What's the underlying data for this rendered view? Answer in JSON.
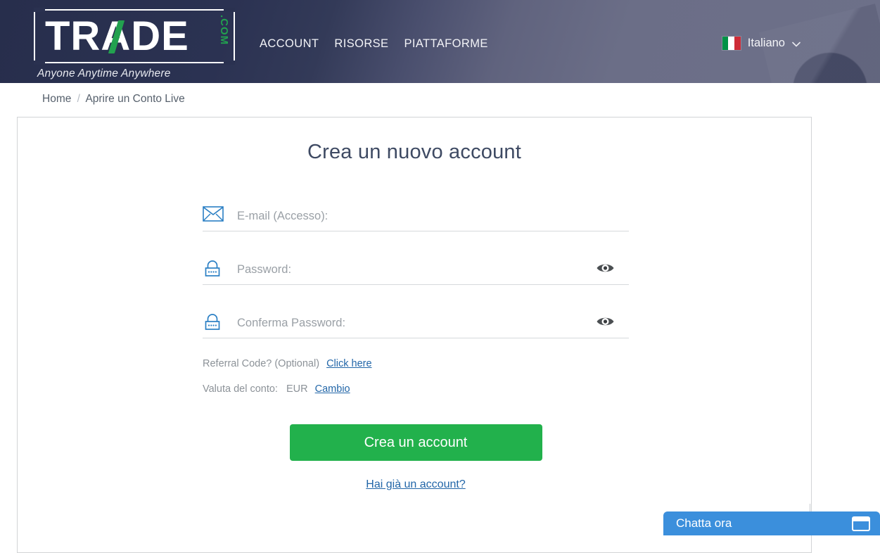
{
  "header": {
    "logo": {
      "word": "TRADE",
      "suffix": ".COM",
      "tagline": "Anyone Anytime Anywhere"
    },
    "nav": [
      {
        "label": "ACCOUNT"
      },
      {
        "label": "RISORSE"
      },
      {
        "label": "PIATTAFORME"
      }
    ],
    "language": {
      "label": "Italiano",
      "chevron": "⌄",
      "flag": "italy-flag"
    },
    "colors": {
      "dark": "#272e4c",
      "light": "#6d7089",
      "accent_green": "#22a14f"
    }
  },
  "breadcrumb": {
    "home": "Home",
    "separator": "/",
    "current": "Aprire un Conto Live"
  },
  "main": {
    "title": "Crea un nuovo account",
    "fields": [
      {
        "name": "email",
        "placeholder": "E-mail (Accesso):",
        "value": "",
        "icon": "envelope-icon"
      },
      {
        "name": "password",
        "placeholder": "Password:",
        "value": "",
        "icon": "lock-icon",
        "toggle": "eye-icon"
      },
      {
        "name": "confirm_password",
        "placeholder": "Conferma Password:",
        "value": "",
        "icon": "lock-icon",
        "toggle": "eye-icon"
      }
    ],
    "referral": {
      "text": "Referral Code? (Optional)",
      "link": "Click here"
    },
    "currency": {
      "label": "Valuta del conto:",
      "value": "EUR",
      "link": "Cambio"
    },
    "submit": "Crea un account",
    "login_link": "Hai già un account?",
    "colors": {
      "submit_green": "#22b14c",
      "link_blue": "#2266a8",
      "title": "#3e4a63"
    }
  },
  "chat": {
    "label": "Chatta ora",
    "icon": "window-icon",
    "color": "#3b8fdc"
  }
}
